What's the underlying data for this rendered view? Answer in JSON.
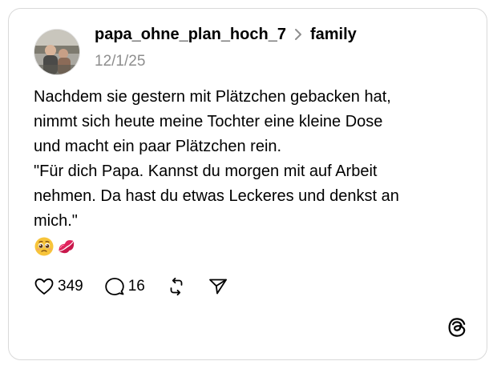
{
  "post": {
    "author": "papa_ohne_plan_hoch_7",
    "community": "family",
    "timestamp": "12/1/25",
    "text_lines": [
      "Nachdem sie gestern mit Plätzchen gebacken hat,",
      "nimmt sich heute meine Tochter eine kleine Dose",
      "und macht ein paar Plätzchen rein.",
      "\"Für dich Papa. Kannst du morgen mit auf Arbeit",
      "nehmen. Da hast du etwas Leckeres und denkst an",
      "mich.\""
    ],
    "emojis": [
      "pleading-face-emoji",
      "kiss-mark-emoji"
    ]
  },
  "actions": {
    "likes": "349",
    "replies": "16",
    "like_icon": "heart-icon",
    "reply_icon": "speech-bubble-icon",
    "repost_icon": "repost-icon",
    "share_icon": "send-icon"
  },
  "branding": {
    "logo": "threads-logo-icon"
  },
  "colors": {
    "text": "#000000",
    "muted": "#8e8e8e",
    "border": "#d9d9d9",
    "kiss_red": "#e0245e",
    "emoji_yellow": "#f7c43a"
  }
}
